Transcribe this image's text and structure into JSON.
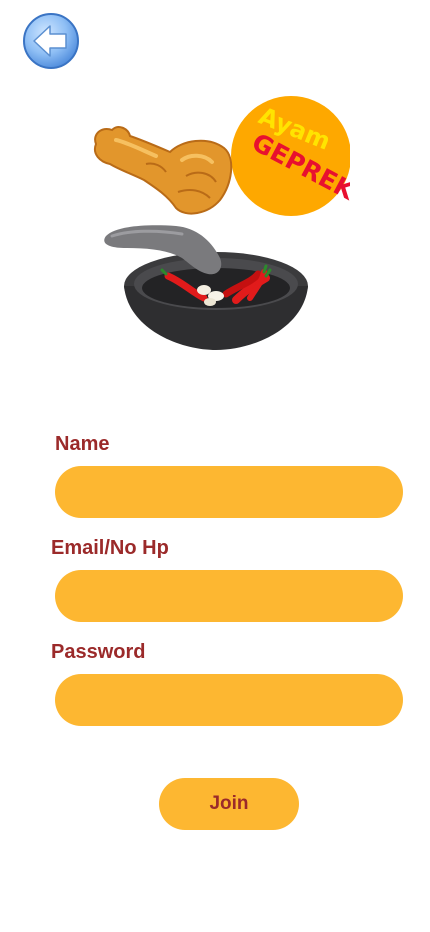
{
  "header": {
    "back_icon": "back-arrow-icon"
  },
  "logo": {
    "text_line1": "Ayam",
    "text_line2": "GEPREK",
    "colors": {
      "badge": "#fea800",
      "text_top": "#ffe400",
      "text_bottom": "#e8102f",
      "chicken": "#e2962c",
      "mortar": "#2e2e30",
      "chili": "#e11b1b"
    }
  },
  "form": {
    "name_label": "Name",
    "name_value": "",
    "email_label": "Email/No Hp",
    "email_value": "",
    "password_label": "Password",
    "password_value": "",
    "submit_label": "Join"
  },
  "theme": {
    "field_color": "#fdb731",
    "label_color": "#9b2a2a"
  }
}
